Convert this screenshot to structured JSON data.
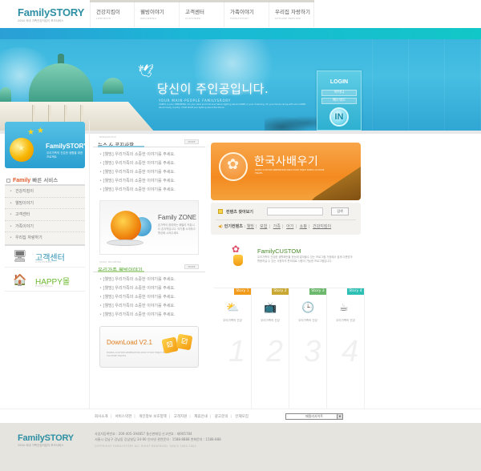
{
  "header": {
    "logo": "FamilySTORY",
    "logo_sub": "2004 국내 가족건강지킴이 포크서비스",
    "nav": [
      {
        "label": "건강지킴이",
        "sub": "LIFEHELTH"
      },
      {
        "label": "웰빙이야기",
        "sub": "WELLBEING"
      },
      {
        "label": "고객센터",
        "sub": "CUSTOMER"
      },
      {
        "label": "가족이야기",
        "sub": "FAMILYSTORY"
      },
      {
        "label": "우리집 자랑하기",
        "sub": "MYHOME PREVIEW"
      }
    ]
  },
  "banner": {
    "title": "당신이 주인공입니다.",
    "subtitle": "YOUR MAIN-PEOPLE FAMILYSRORY",
    "desc": "CARPIL in your DREAMING. On your wind and kind soul future lighting about CARPIL in your dreaming. On your future caring with soul CARPIL about lovely country. YOUR MAIN soul lighting about the future."
  },
  "login": {
    "title": "LOGIN",
    "id_placeholder": "아이디",
    "pw_placeholder": "패스워드",
    "button": "IN"
  },
  "sidebar": {
    "promo_title": "FamilySTORY",
    "promo_desc": "우리가족의 건강한 생활을 위한 프로젝트",
    "quick_brand": "Family",
    "quick_title": " 빠른 서비스",
    "quick_items": [
      "건강지킴이",
      "웰빙이야기",
      "고객센터",
      "가족이야기",
      "우리집 자랑하기"
    ],
    "cs_label": "고객센터",
    "cs_sub": "CUSTOMER",
    "happy_label": "HAPPY몰",
    "happy_sub": "HAPPYMALL"
  },
  "news": {
    "eyebrow": "NEWS&NOTICE",
    "title": "뉴스 & 공지사항",
    "more": "MORE",
    "items": [
      "[웰빙] 우리가족의 소중한 이야기를 주세요.",
      "[웰빙] 우리가족의 소중한 이야기를 주세요.",
      "[웰빙] 우리가족의 소중한 이야기를 주세요.",
      "[웰빙] 우리가족의 소중한 이야기를 주세요.",
      "[웰빙] 우리가족의 소중한 이야기를 주세요."
    ]
  },
  "zone": {
    "title": "Family ZONE",
    "desc": "온가족이 참여하는 패밀리 커뮤니티 존지역입니다. 여기를 소개하고 활성화 시켜주세요."
  },
  "wellbeing": {
    "eyebrow": "FAMILY WELLBEING",
    "title": "우리가족 웰빙이야기",
    "more": "MORE",
    "items": [
      "[웰빙] 우리가족의 소중한 이야기를 주세요.",
      "[웰빙] 우리가족의 소중한 이야기를 주세요.",
      "[웰빙] 우리가족의 소중한 이야기를 주세요.",
      "[웰빙] 우리가족의 소중한 이야기를 주세요.",
      "[웰빙] 우리가족의 소중한 이야기를 주세요."
    ]
  },
  "download": {
    "title": "DownLoad V2.1",
    "desc": "KOREA CUSTOM GENERATION 2004 STUDY ENJOY KOREA CLUTURE TRAVEL"
  },
  "korea": {
    "title": "한국사배우기",
    "desc": "KOREA CUSTOM GENERATION 2004 STUDY ENJOY KOREA CLUTURE TRAVEL"
  },
  "search": {
    "label": "컨텐츠 찾아보기",
    "value": "",
    "button": "검색",
    "popular_title": "인기컨텐츠",
    "popular": [
      "웰빙",
      "보험",
      "가족",
      "아기",
      "쇼핑",
      "건강지킴이"
    ]
  },
  "custom": {
    "title": "FamilyCUSTOM",
    "desc": "우리가족의 건강한 생활패턴을 한눈에 알아볼수 있는 프로그램 가정에서 쉽게 다운받아 활용하실 수 있는 사용자의 편의대로 사용이 가능한 프로그램입니다."
  },
  "stories": [
    {
      "tag": "Story 1",
      "caption": "우리가족의 건강",
      "num": "1",
      "icon": "sun-cloud-icon",
      "color": "#f29a1a"
    },
    {
      "tag": "Story 2",
      "caption": "우리가족의 건강",
      "num": "2",
      "icon": "tv-icon",
      "color": "#c8a832"
    },
    {
      "tag": "Story 3",
      "caption": "우리가족의 건강",
      "num": "3",
      "icon": "clock-icon",
      "color": "#6cb86c"
    },
    {
      "tag": "Story 4",
      "caption": "우리가족의 건강",
      "num": "4",
      "icon": "cup-icon",
      "color": "#2ec0b4"
    }
  ],
  "footer": {
    "links": [
      "회사소개",
      "서비스약관",
      "개인정보 보호정책",
      "고객지원",
      "제휴안내",
      "광고문의",
      "인재모집"
    ],
    "family_site": "패밀리사이트",
    "logo": "FamilySTORY",
    "logo_sub": "2004 국내 가족건강지킴이 포크서비스",
    "info_line1": "사업자등록번호 : 200-405-394857   통신판매업 신고번호 : 제905784",
    "info_line2": "서울시 강남구 강남동 강남빌딩 34-90   인터넷 관련문의 : 1588-8888 변화문의 : 1588-888",
    "copyright": "COPYRIGHT FAMILYSTORY ALL RIGHT RESERVED. SINCE 1900 2004"
  }
}
